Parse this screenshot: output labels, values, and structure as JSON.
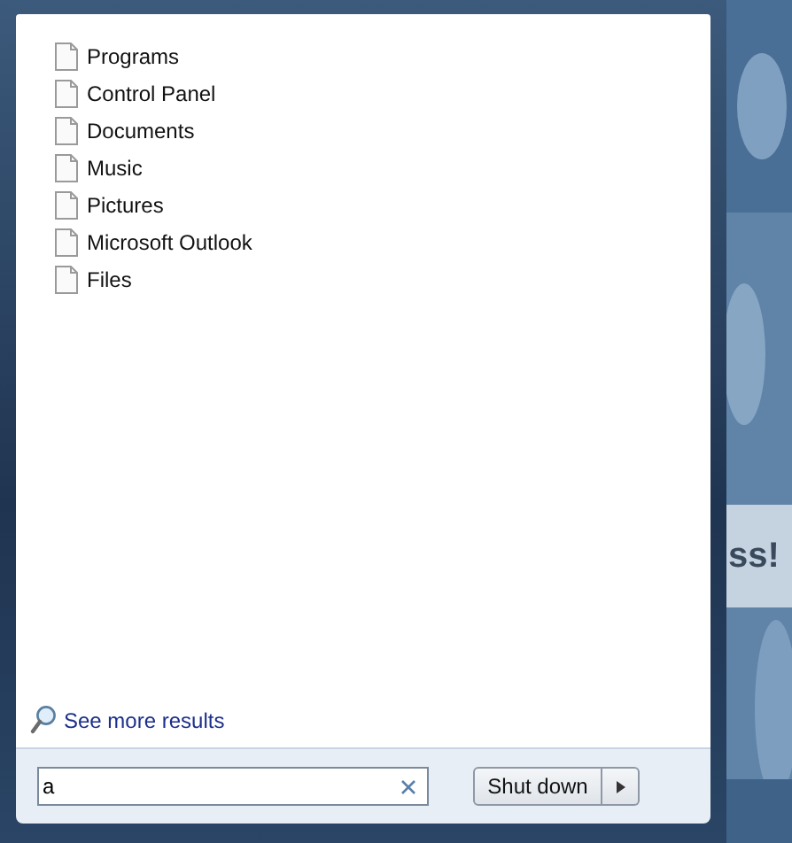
{
  "search_results": [
    {
      "label": "Programs"
    },
    {
      "label": "Control Panel"
    },
    {
      "label": "Documents"
    },
    {
      "label": "Music"
    },
    {
      "label": "Pictures"
    },
    {
      "label": "Microsoft Outlook"
    },
    {
      "label": "Files"
    }
  ],
  "see_more": {
    "label": "See more results"
  },
  "search": {
    "value": "a"
  },
  "shutdown": {
    "label": "Shut down"
  },
  "desktop": {
    "banner": "ss!"
  }
}
